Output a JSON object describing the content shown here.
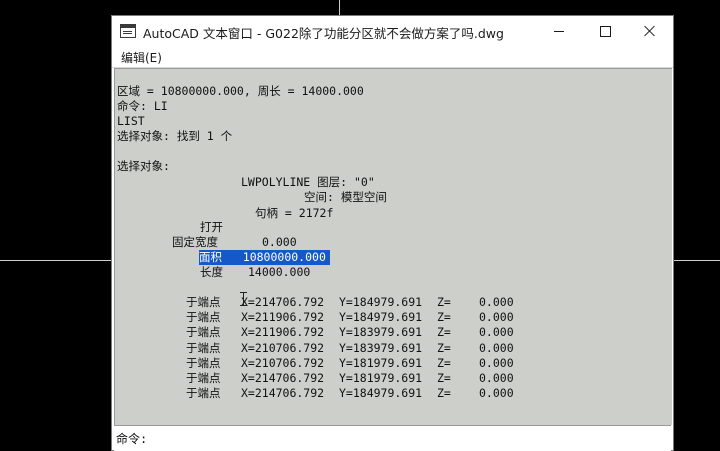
{
  "window": {
    "title": "AutoCAD 文本窗口 - G022除了功能分区就不会做方案了吗.dwg"
  },
  "menu": {
    "edit_label": "编辑(E)"
  },
  "text_lines": {
    "area_perimeter": "区域 = 10800000.000, 周长 = 14000.000",
    "command_li": "命令: LI",
    "list": "LIST",
    "select_found": "选择对象: 找到 1 个",
    "select_objects": "选择对象:",
    "lwpolyline_layer": "LWPOLYLINE 图层: \"0\"",
    "space": "空间: 模型空间",
    "handle": "句柄 = 2172f",
    "open": "打开",
    "const_width_label": "固定宽度",
    "const_width_value": "0.000",
    "area_label": "面积",
    "area_value": "10800000.000",
    "length_label": "长度",
    "length_value": "14000.000"
  },
  "vertices": [
    {
      "label": "于端点",
      "x": "X=214706.792",
      "y": "Y=184979.691",
      "z_label": "Z=",
      "z": "0.000"
    },
    {
      "label": "于端点",
      "x": "X=211906.792",
      "y": "Y=184979.691",
      "z_label": "Z=",
      "z": "0.000"
    },
    {
      "label": "于端点",
      "x": "X=211906.792",
      "y": "Y=183979.691",
      "z_label": "Z=",
      "z": "0.000"
    },
    {
      "label": "于端点",
      "x": "X=210706.792",
      "y": "Y=183979.691",
      "z_label": "Z=",
      "z": "0.000"
    },
    {
      "label": "于端点",
      "x": "X=210706.792",
      "y": "Y=181979.691",
      "z_label": "Z=",
      "z": "0.000"
    },
    {
      "label": "于端点",
      "x": "X=214706.792",
      "y": "Y=181979.691",
      "z_label": "Z=",
      "z": "0.000"
    },
    {
      "label": "于端点",
      "x": "X=214706.792",
      "y": "Y=184979.691",
      "z_label": "Z=",
      "z": "0.000"
    }
  ],
  "command_bar": {
    "label": "命令:",
    "value": ""
  },
  "colors": {
    "text_background": "#cdcfca",
    "highlight": "#1558c8",
    "canvas_background": "#000000"
  },
  "icons": {
    "app": "text-window-icon",
    "minimize": "minimize-icon",
    "maximize": "maximize-icon",
    "close": "close-icon",
    "cursor": "ibeam-cursor-icon"
  }
}
